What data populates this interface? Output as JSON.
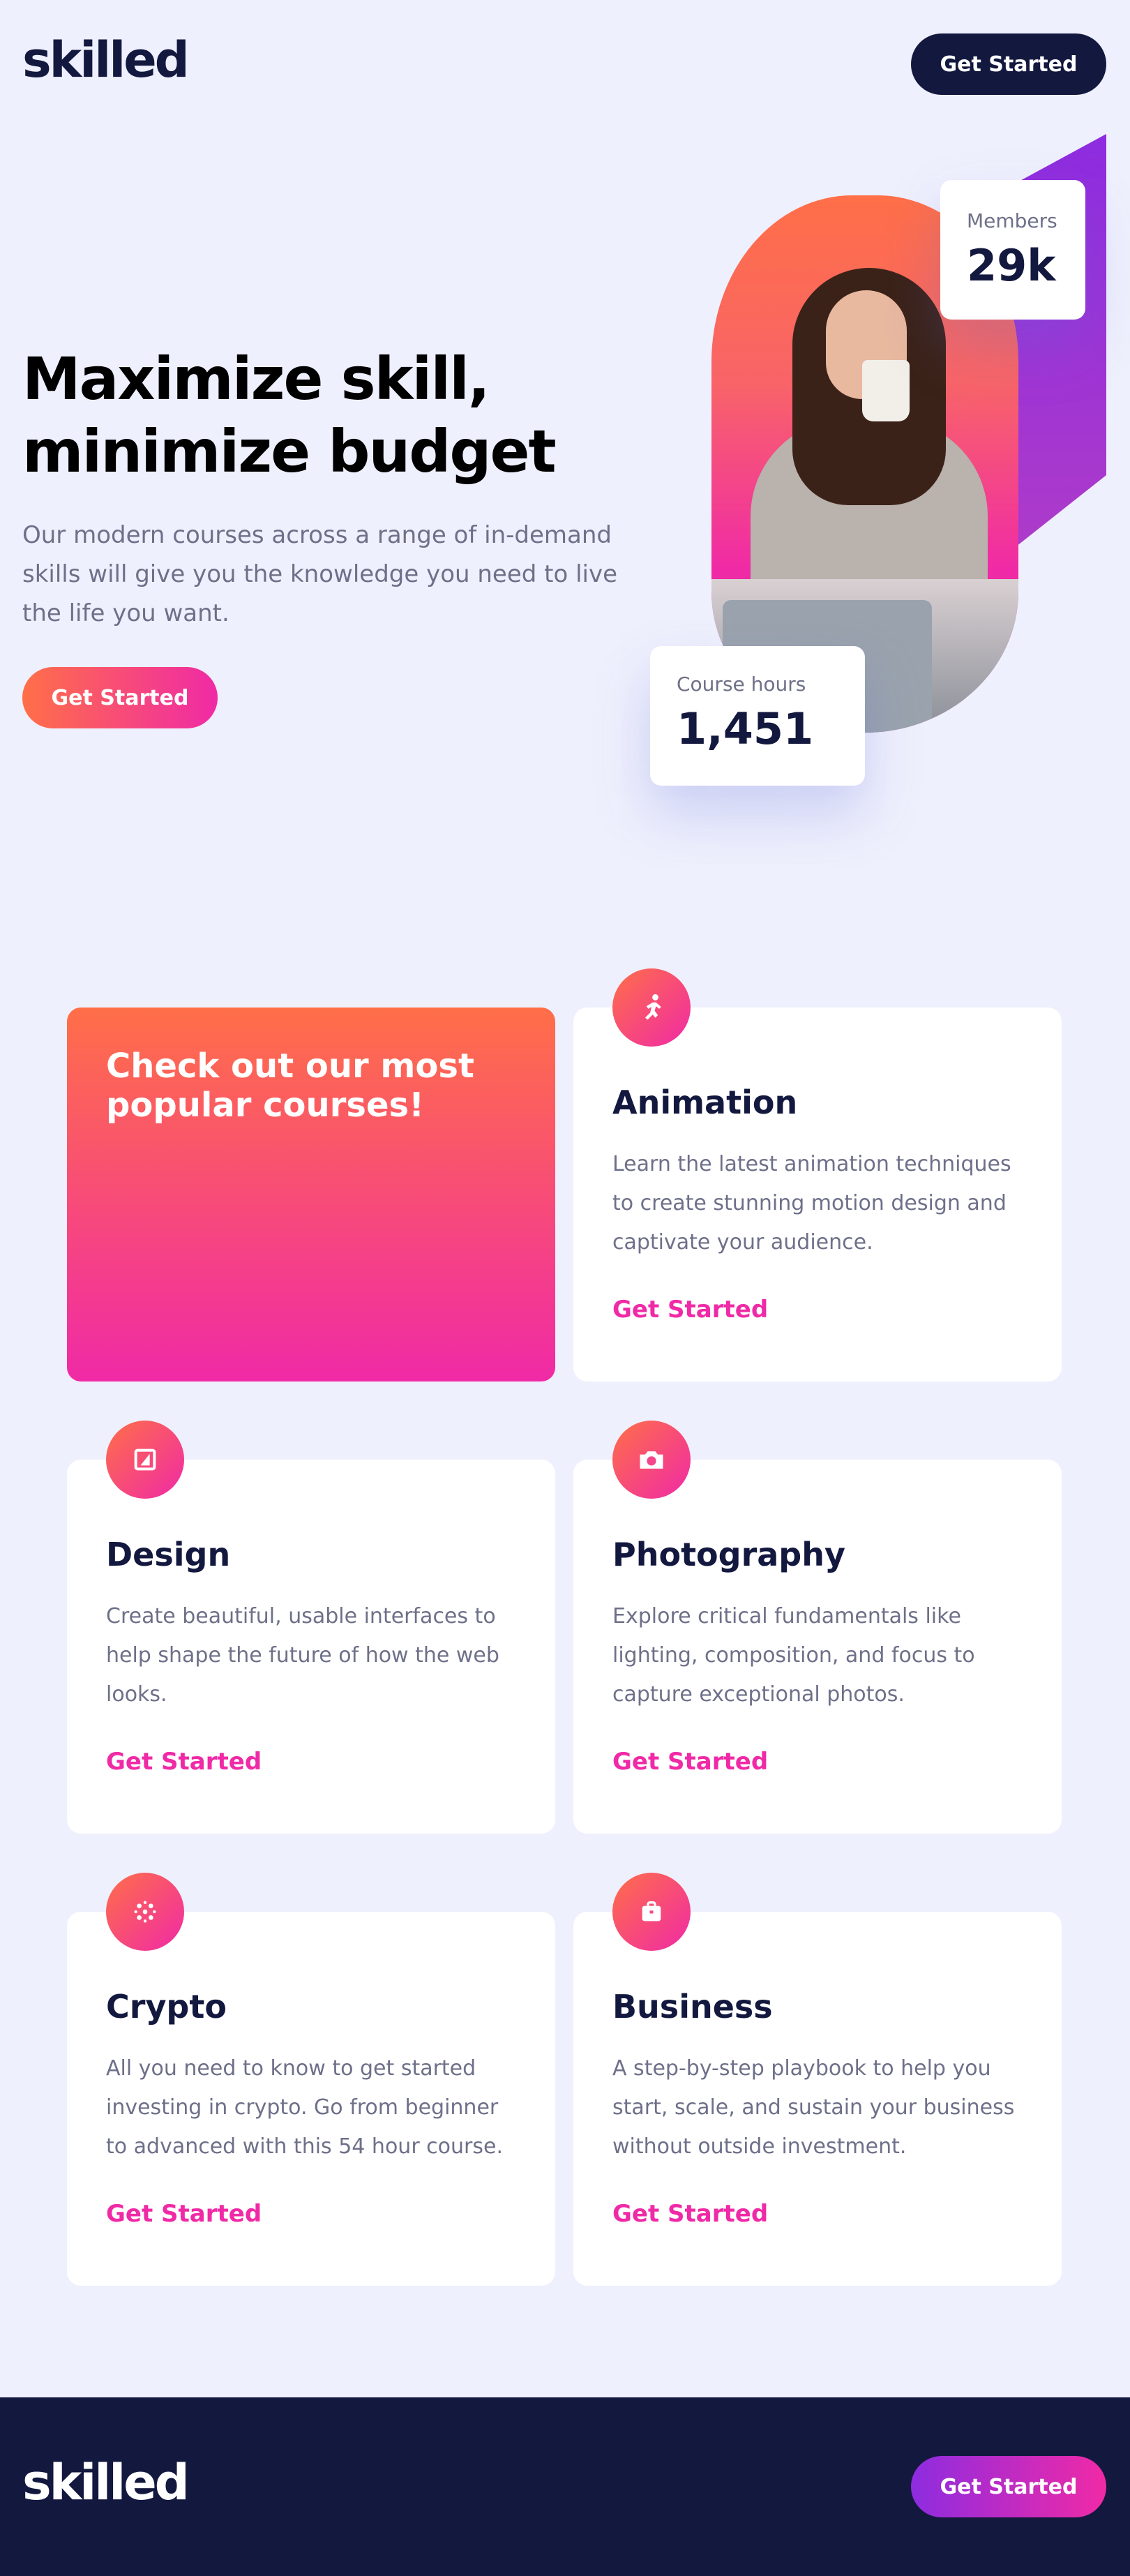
{
  "brand": {
    "logo": "skilled"
  },
  "header": {
    "cta_label": "Get Started"
  },
  "hero": {
    "title": "Maximize skill, minimize budget",
    "description": "Our modern courses across a range of in-demand skills will give you the knowledge you need to live the life you want.",
    "cta_label": "Get Started",
    "stats": {
      "members": {
        "label": "Members",
        "value": "29k"
      },
      "hours": {
        "label": "Course hours",
        "value": "1,451"
      }
    }
  },
  "courses": {
    "feature_title": "Check out our most popular courses!",
    "items": [
      {
        "title": "Animation",
        "description": "Learn the latest animation techniques to create stunning motion design and captivate your audience.",
        "link": "Get Started",
        "icon": "running-figure-icon"
      },
      {
        "title": "Design",
        "description": "Create beautiful, usable interfaces to help shape the future of how the web looks.",
        "link": "Get Started",
        "icon": "design-icon"
      },
      {
        "title": "Photography",
        "description": "Explore critical fundamentals like lighting, composition, and focus to capture exceptional photos.",
        "link": "Get Started",
        "icon": "camera-icon"
      },
      {
        "title": "Crypto",
        "description": "All you need to know to get started investing in crypto. Go from beginner to advanced with this 54 hour course.",
        "link": "Get Started",
        "icon": "crypto-icon"
      },
      {
        "title": "Business",
        "description": "A step-by-step playbook to help you start, scale, and sustain your business without outside investment.",
        "link": "Get Started",
        "icon": "briefcase-icon"
      }
    ]
  },
  "footer": {
    "logo": "skilled",
    "cta_label": "Get Started"
  },
  "colors": {
    "navy": "#13183f",
    "page_bg": "#eff0fd",
    "pink": "#f02aa6",
    "orange": "#ff6f48",
    "violet": "#8d2ce0",
    "grey_text": "#6e7089"
  }
}
